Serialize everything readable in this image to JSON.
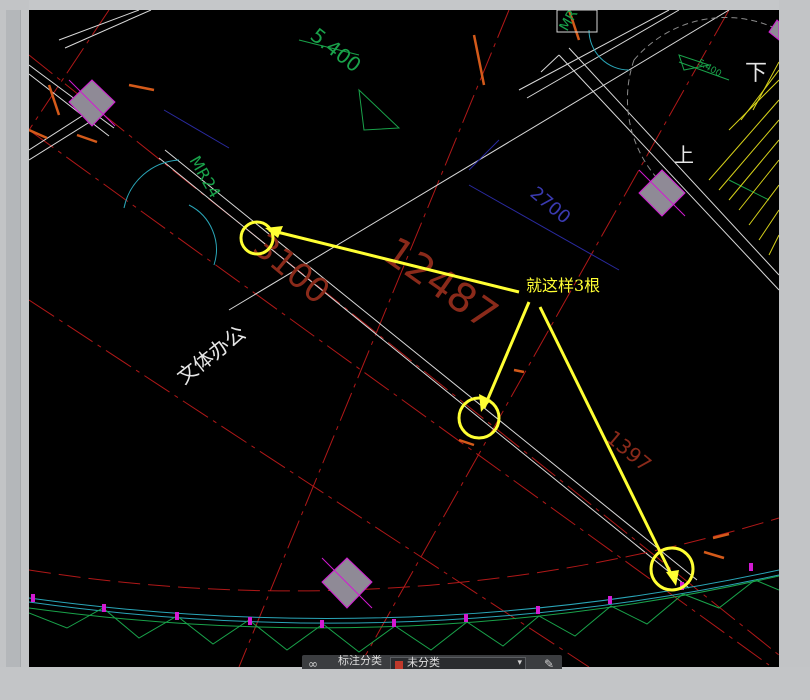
{
  "window": {
    "title": ""
  },
  "drawing": {
    "dims": {
      "d5400_top": "5.400",
      "d5400_right": "5.400",
      "d2700": "2700",
      "d12487": "12487",
      "d3100": "3100",
      "d1397": "1397"
    },
    "door_tags": {
      "mr24": "MR24",
      "top_right": "MR"
    },
    "room_label": "文体办公",
    "stair_label_up": "上",
    "stair_label_down": "下"
  },
  "annotation": {
    "text": "就这样3根",
    "color": "#ffff33",
    "circles": 3
  },
  "status_bar": {
    "label": "标注分类",
    "selected": "未分类"
  },
  "colors": {
    "canvas_bg": "#000000",
    "wall_line": "#d9d9d9",
    "axis_line": "#b01818",
    "dim_text": "#8a2a1a",
    "annotation": "#ffff33",
    "column_fill": "#8f8a96",
    "curtain_green": "#19a24a",
    "cyan_line": "#2aa6b8",
    "stair_yellow": "#d7d21a"
  }
}
